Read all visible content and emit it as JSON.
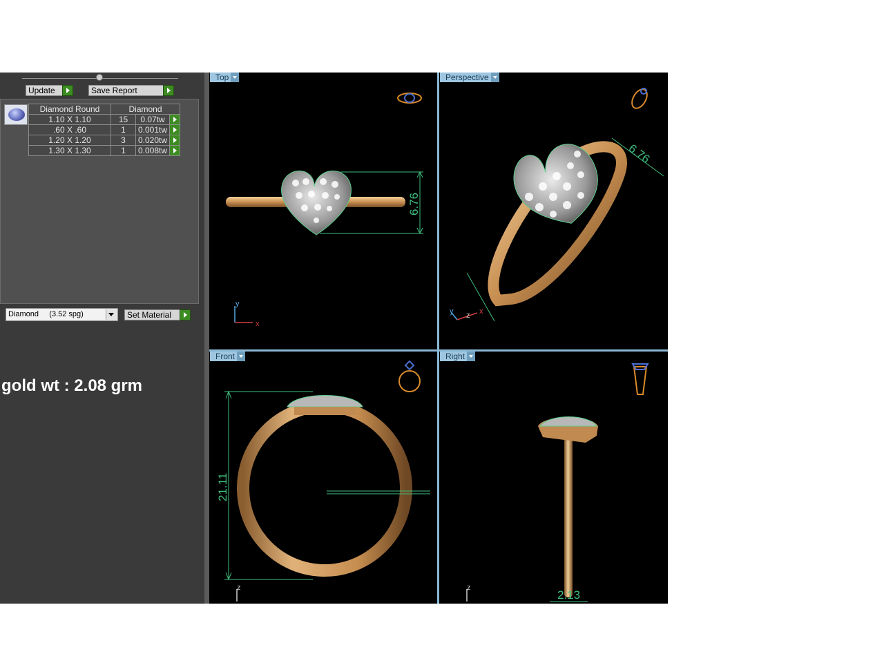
{
  "toolbar": {
    "update_label": "Update",
    "save_report_label": "Save Report"
  },
  "diamond_table": {
    "headers": [
      "Diamond Round",
      "Diamond"
    ],
    "rows": [
      {
        "size": "1.10 X 1.10",
        "count": "15",
        "weight": "0.07tw"
      },
      {
        "size": ".60 X .60",
        "count": "1",
        "weight": "0.001tw"
      },
      {
        "size": "1.20 X 1.20",
        "count": "3",
        "weight": "0.020tw"
      },
      {
        "size": "1.30 X 1.30",
        "count": "1",
        "weight": "0.008tw"
      }
    ]
  },
  "material": {
    "selected": "Diamond     (3.52 spg)",
    "set_label": "Set Material"
  },
  "gold_weight": "gold wt : 2.08 grm",
  "viewports": {
    "top": {
      "label": "Top",
      "dimension": "6.76",
      "axis_y": "y",
      "axis_x": "x"
    },
    "perspective": {
      "label": "Perspective",
      "dimension": "6.76",
      "axis_y": "y",
      "axis_z": "z",
      "axis_x": "x"
    },
    "front": {
      "label": "Front",
      "dimension": "21.11",
      "axis_z": "z"
    },
    "right": {
      "label": "Right",
      "dimension": "2.13",
      "axis_z": "z"
    }
  },
  "colors": {
    "gold": "#d9a56a",
    "dimension": "#3fbf7f",
    "panel": "#3a3a3a",
    "accent_green": "#3c8c22"
  }
}
